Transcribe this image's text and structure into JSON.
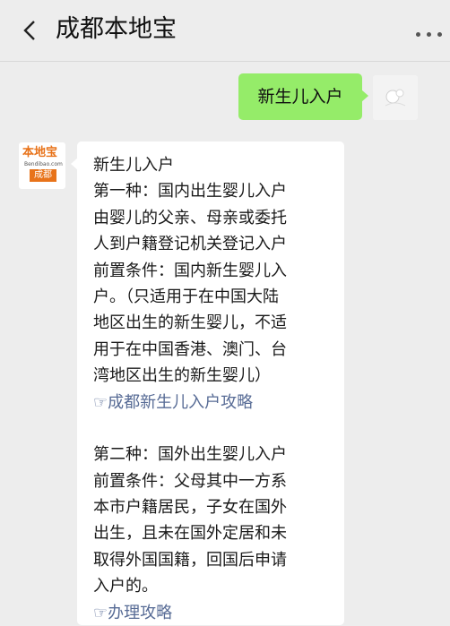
{
  "header": {
    "title": "成都本地宝"
  },
  "messages": {
    "outgoing": {
      "text": "新生儿入户"
    },
    "incoming": {
      "avatar": {
        "brand": "本地宝",
        "site": "Bendibao.com",
        "city": "成都"
      },
      "lines": [
        "新生儿入户",
        "第一种：国内出生婴儿入户",
        "由婴儿的父亲、母亲或委托",
        "人到户籍登记机关登记入户",
        "前置条件：国内新生婴儿入",
        "户。（只适用于在中国大陆",
        "地区出生的新生婴儿，不适",
        "用于在中国香港、澳门、台",
        "湾地区出生的新生婴儿）"
      ],
      "link1": "☞成都新生儿入户攻略",
      "lines2": [
        "第二种：国外出生婴儿入户",
        "前置条件：父母其中一方系",
        "本市户籍居民，子女在国外",
        "出生，且未在国外定居和未",
        "取得外国国籍，回国后申请",
        "入户的。"
      ],
      "link2": "☞办理攻略"
    }
  }
}
